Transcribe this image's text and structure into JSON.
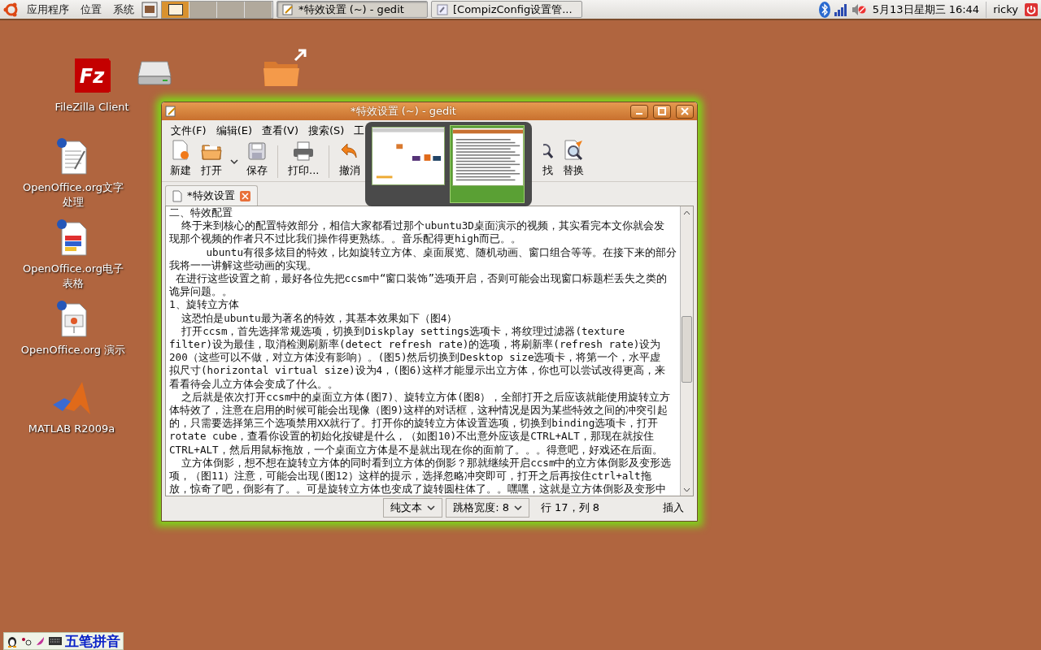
{
  "top_panel": {
    "menus": [
      "应用程序",
      "位置",
      "系统"
    ],
    "workspaces": [
      {
        "selected": true
      },
      {
        "selected": false
      },
      {
        "selected": false
      },
      {
        "selected": false
      }
    ],
    "tasks": [
      {
        "label": "*特效设置 (~) - gedit",
        "selected": true
      },
      {
        "label": "[CompizConfig设置管...",
        "selected": false
      }
    ],
    "clock": "5月13日星期三 16:44",
    "user": "ricky"
  },
  "desktop_icons": [
    {
      "kind": "filezilla",
      "logo_text": "Fz",
      "label": "FileZilla Client"
    },
    {
      "kind": "drive"
    },
    {
      "kind": "folder"
    },
    {
      "kind": "writer",
      "label": "OpenOffice.org文字处理"
    },
    {
      "kind": "calc",
      "label": "OpenOffice.org电子表格"
    },
    {
      "kind": "impress",
      "label": "OpenOffice.org 演示"
    },
    {
      "kind": "matlab",
      "label": "MATLAB R2009a"
    }
  ],
  "window": {
    "title": "*特效设置 (~) - gedit",
    "menu": [
      "文件(F)",
      "编辑(E)",
      "查看(V)",
      "搜索(S)",
      "工"
    ],
    "toolbar": [
      {
        "kind": "new",
        "label": "新建"
      },
      {
        "kind": "open",
        "label": "打开"
      },
      {
        "kind": "caret"
      },
      {
        "kind": "save",
        "label": "保存"
      },
      {
        "kind": "sep"
      },
      {
        "kind": "print",
        "label": "打印..."
      },
      {
        "kind": "sep"
      },
      {
        "kind": "undo",
        "label": "撤消"
      },
      {
        "kind": "gap"
      },
      {
        "kind": "find",
        "label": "找"
      },
      {
        "kind": "replace",
        "label": "替换"
      }
    ],
    "tab": {
      "label": "*特效设置"
    },
    "lines": [
      "二、特效配置",
      "  终于来到核心的配置特效部分，相信大家都看过那个ubuntu3D桌面演示的视频，其实看完本文你就会发",
      "现那个视频的作者只不过比我们操作得更熟练。。音乐配得更high而已。。",
      "      ubuntu有很多炫目的特效，比如旋转立方体、桌面展览、随机动画、窗口组合等等。在接下来的部分",
      "我将一一讲解这些动画的实现。",
      " 在进行这些设置之前，最好各位先把ccsm中“窗口装饰”选项开启，否则可能会出现窗口标题栏丢失之类的",
      "诡异问题。。",
      "1、旋转立方体",
      "  这恐怕是ubuntu最为著名的特效，其基本效果如下（图4）",
      "  打开ccsm，首先选择常规选项，切换到Diskplay settings选项卡，将纹理过滤器(texture",
      "filter)设为最佳，取消检测刷新率(detect refresh rate)的选项，将刷新率(refresh rate)设为",
      "200（这些可以不做，对立方体没有影响）。(图5)然后切换到Desktop size选项卡，将第一个，水平虚",
      "拟尺寸(horizontal virtual size)设为4，(图6)这样才能显示出立方体，你也可以尝试改得更高，来",
      "看看待会儿立方体会变成了什么。。",
      "  之后就是依次打开ccsm中的桌面立方体(图7)、旋转立方体(图8），全部打开之后应该就能使用旋转立方",
      "体特效了，注意在启用的时候可能会出现像（图9)这样的对话框，这种情况是因为某些特效之间的冲突引起",
      "的，只需要选择第三个选项禁用XX就行了。打开你的旋转立方体设置选项，切换到binding选项卡，打开",
      "rotate cube，查看你设置的初始化按键是什么，（如图10)不出意外应该是CTRL+ALT，那现在就按住",
      "CTRL+ALT，然后用鼠标拖放，一个桌面立方体是不是就出现在你的面前了。。。得意吧，好戏还在后面。",
      "  立方体倒影，想不想在旋转立方体的同时看到立方体的倒影？那就继续开启ccsm中的立方体倒影及变形选",
      "项，（图11）注意，可能会出现(图12）这样的提示，选择忽略冲突即可，打开之后再按住ctrl+alt拖",
      "放，惊奇了吧，倒影有了。。可是旋转立方体也变成了旋转圆柱体了。。嘿嘿，这就是立方体倒影及变形中"
    ],
    "status": {
      "language": "纯文本",
      "tab_width": "跳格宽度: 8",
      "position": "行 17，列 8",
      "mode": "插入"
    }
  },
  "switcher": [
    {
      "kind": "desktop",
      "selected": false
    },
    {
      "kind": "editor",
      "selected": true
    }
  ],
  "input_bar": {
    "label": "五笔拼音"
  }
}
